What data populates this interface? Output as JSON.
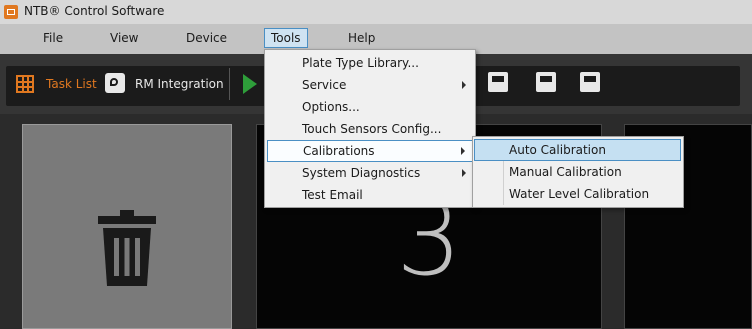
{
  "window": {
    "title": "NTB® Control Software"
  },
  "menubar": {
    "file": "File",
    "view": "View",
    "device": "Device",
    "tools": "Tools",
    "help": "Help"
  },
  "toolbar": {
    "task_list": "Task List",
    "rm_integration": "RM Integration"
  },
  "tools_menu": [
    {
      "label": "Plate Type Library..."
    },
    {
      "label": "Service"
    },
    {
      "label": "Options..."
    },
    {
      "label": "Touch Sensors Config..."
    },
    {
      "label": "Calibrations"
    },
    {
      "label": "System Diagnostics"
    },
    {
      "label": "Test Email"
    }
  ],
  "calibrations_menu": [
    {
      "label": "Auto Calibration"
    },
    {
      "label": "Manual Calibration"
    },
    {
      "label": "Water Level Calibration"
    }
  ],
  "main": {
    "big_number": "3"
  },
  "colors": {
    "accent_orange": "#e07820",
    "highlight_blue": "#4a8fc4",
    "play_green": "#2e9e3a"
  }
}
